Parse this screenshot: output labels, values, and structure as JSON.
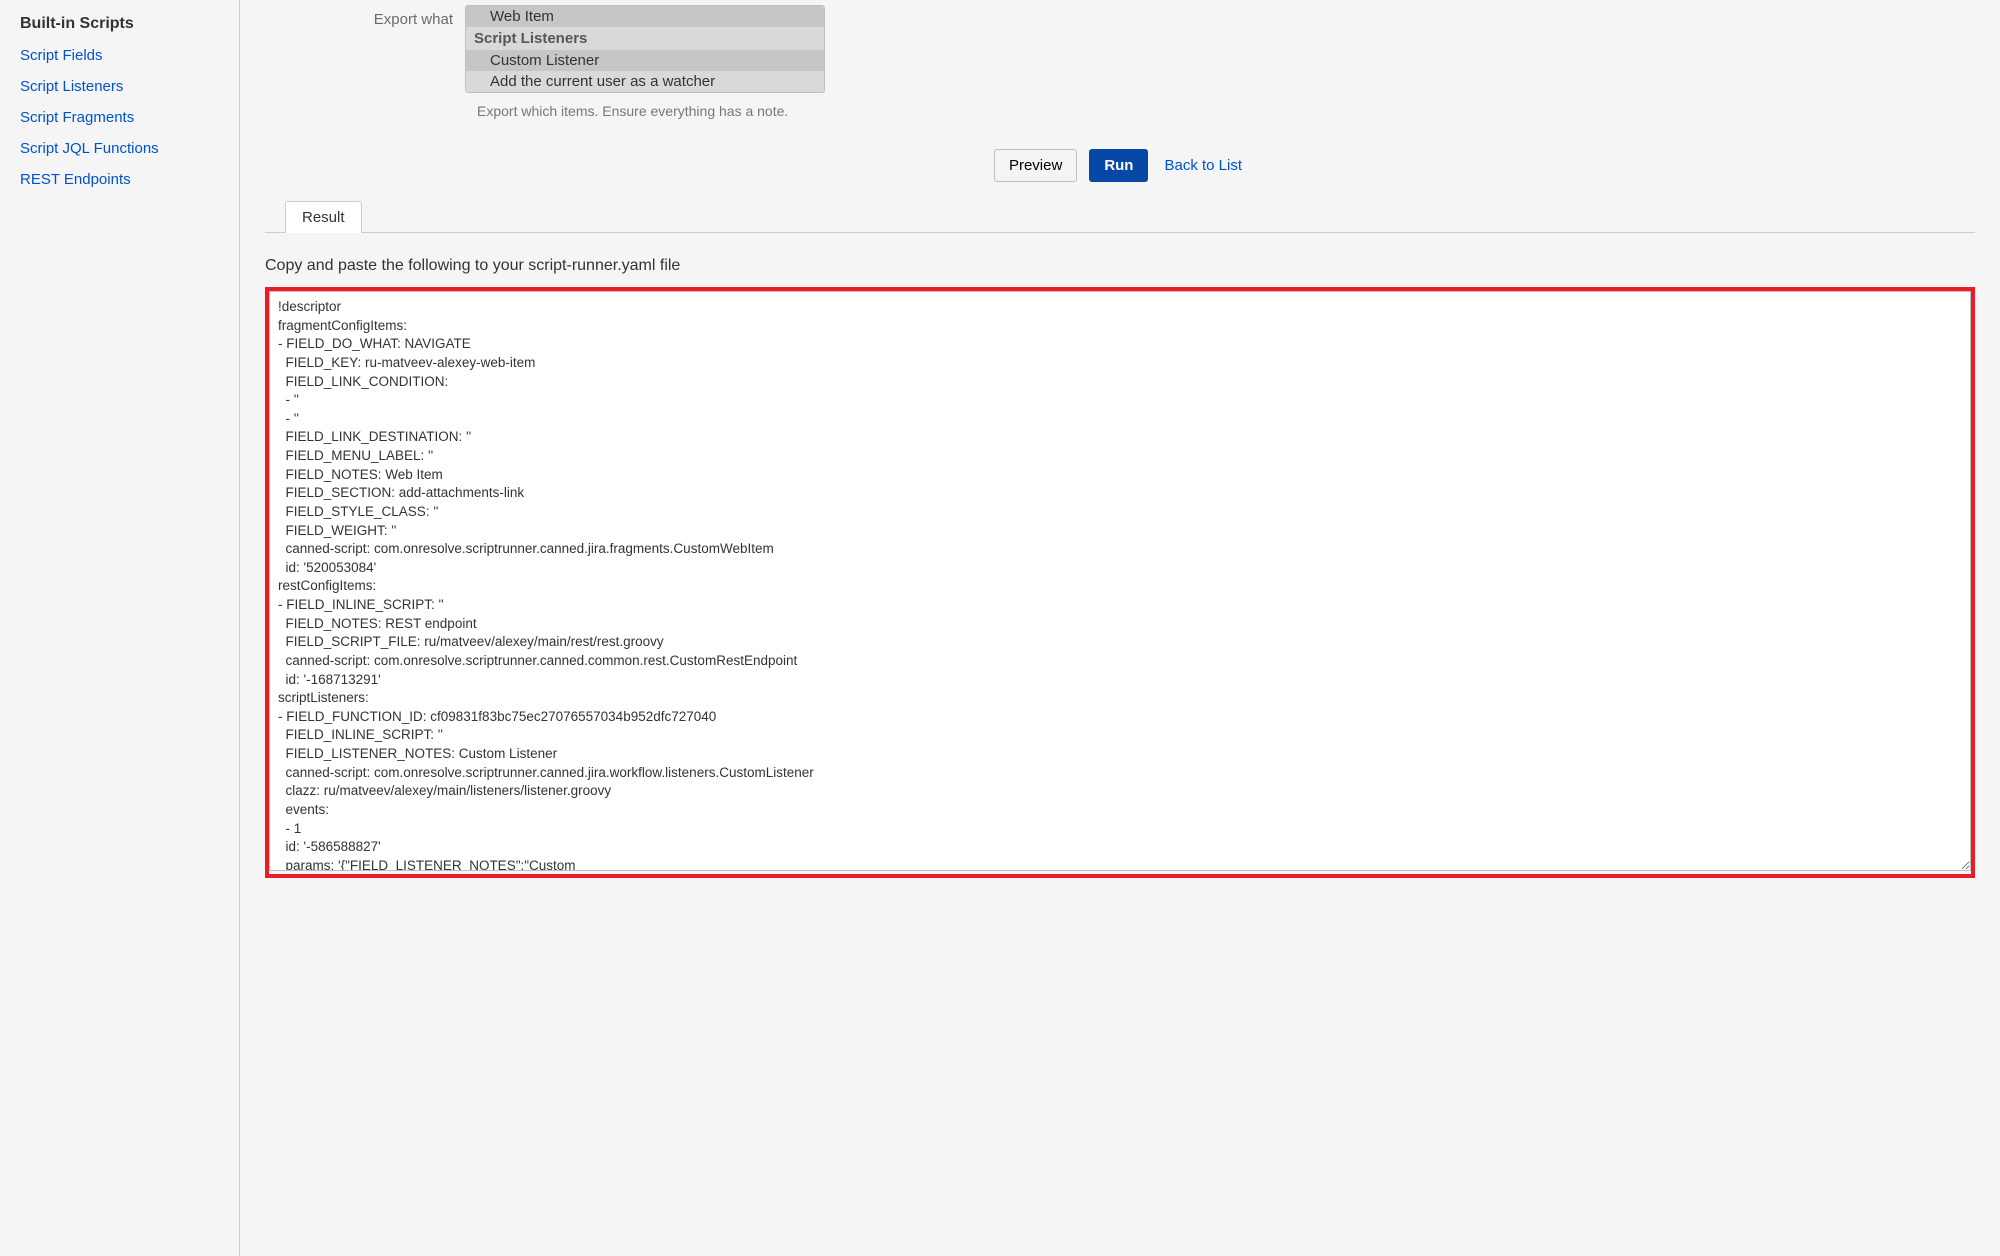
{
  "sidebar": {
    "heading": "Built-in Scripts",
    "items": [
      {
        "label": "Script Fields"
      },
      {
        "label": "Script Listeners"
      },
      {
        "label": "Script Fragments"
      },
      {
        "label": "Script JQL Functions"
      },
      {
        "label": "REST Endpoints"
      }
    ]
  },
  "form": {
    "export_label": "Export what",
    "listbox": {
      "option_web_item": "Web Item",
      "group_listeners": "Script Listeners",
      "option_custom_listener": "Custom Listener",
      "option_add_watcher": "Add the current user as a watcher"
    },
    "helper": "Export which items. Ensure everything has a note."
  },
  "buttons": {
    "preview": "Preview",
    "run": "Run",
    "back": "Back to List"
  },
  "tabs": {
    "result": "Result"
  },
  "result": {
    "heading": "Copy and paste the following to your script-runner.yaml file",
    "yaml": "!descriptor\nfragmentConfigItems:\n- FIELD_DO_WHAT: NAVIGATE\n  FIELD_KEY: ru-matveev-alexey-web-item\n  FIELD_LINK_CONDITION:\n  - ''\n  - ''\n  FIELD_LINK_DESTINATION: ''\n  FIELD_MENU_LABEL: ''\n  FIELD_NOTES: Web Item\n  FIELD_SECTION: add-attachments-link\n  FIELD_STYLE_CLASS: ''\n  FIELD_WEIGHT: ''\n  canned-script: com.onresolve.scriptrunner.canned.jira.fragments.CustomWebItem\n  id: '520053084'\nrestConfigItems:\n- FIELD_INLINE_SCRIPT: ''\n  FIELD_NOTES: REST endpoint\n  FIELD_SCRIPT_FILE: ru/matveev/alexey/main/rest/rest.groovy\n  canned-script: com.onresolve.scriptrunner.canned.common.rest.CustomRestEndpoint\n  id: '-168713291'\nscriptListeners:\n- FIELD_FUNCTION_ID: cf09831f83bc75ec27076557034b952dfc727040\n  FIELD_INLINE_SCRIPT: ''\n  FIELD_LISTENER_NOTES: Custom Listener\n  canned-script: com.onresolve.scriptrunner.canned.jira.workflow.listeners.CustomListener\n  clazz: ru/matveev/alexey/main/listeners/listener.groovy\n  events:\n  - 1\n  id: '-586588827'\n  params: '{\"FIELD_LISTENER_NOTES\":\"Custom\nListener\",\"projects\":\"\",\"events\":\"1\",\"FIELD_INLINE_SCRIPT\":\"\",\"clazz\":\"ru/matveev/alexey/main/listeners/listener.groovy\",\"FIELD_FUNCTION_ID\":\"cf09831f83bc75ec27076557034b952dfc727040\",\"canned-script\":\"com.onresolve.scriptrunner.canned.jira.workflow.listeners.CustomListener\",\"id\":\"-268926325\"}'\n  projects:\n  - ''\n- FIELD_CONDITION: []\n  FIELD_FUNCTION_ID: ''\n  FIELD_LISTENER_NOTES: Add the current user as a watcher\n  canned-script: com.onresolve.scriptrunner.canned.jira.workflow.postfunctions.AddWatcher\n  events:\n  - 1\n  params: '{\"FIELD_LISTENER_NOTES\":\"Add the current user as a watcher\",\"projects\":\"\",\"events\":\"1\",\"FIELD_CONDITION\":[\"\",\"\"],\"FIELD_FUNCTION_ID\":\"\",\"canned-"
  }
}
